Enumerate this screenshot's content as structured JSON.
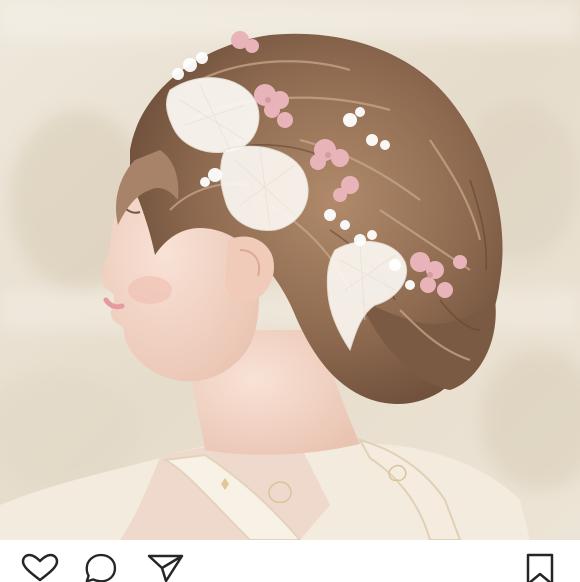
{
  "post": {
    "image": {
      "alt": "",
      "colors": {
        "background": "#e9dfd0",
        "hair": "#9a7458",
        "skin": "#f3d5c6",
        "lace": "#fbf7f2",
        "flower_pink": "#e9b4b9",
        "kimono": "#f2eadc"
      }
    },
    "actions": {
      "like": {
        "icon": "heart-icon"
      },
      "comment": {
        "icon": "speech-bubble-icon"
      },
      "share": {
        "icon": "paper-plane-icon"
      },
      "save": {
        "icon": "bookmark-icon"
      }
    }
  }
}
